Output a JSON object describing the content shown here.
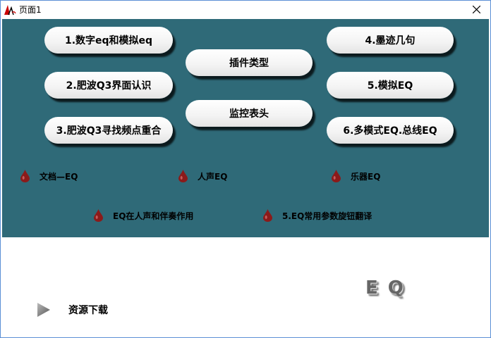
{
  "window": {
    "title": "页面1"
  },
  "buttons": [
    {
      "label": "1.数字eq和模拟eq"
    },
    {
      "label": "2.肥波Q3界面认识"
    },
    {
      "label": "3.肥波Q3寻找频点重合"
    },
    {
      "label": "插件类型"
    },
    {
      "label": "监控表头"
    },
    {
      "label": "4.墨迹几句"
    },
    {
      "label": "5.模拟EQ"
    },
    {
      "label": "6.多模式EQ.总线EQ"
    }
  ],
  "links": [
    {
      "label": "文档—EQ"
    },
    {
      "label": "人声EQ"
    },
    {
      "label": "乐器EQ"
    },
    {
      "label": "EQ在人声和伴奏作用"
    },
    {
      "label": "5.EQ常用参数旋钮翻译"
    }
  ],
  "download": {
    "label": "资源下载",
    "icon": "play-icon"
  },
  "logo": {
    "text": "EQ"
  },
  "colors": {
    "main_bg": "#2f6a78",
    "drop": "#8b1a1a"
  }
}
